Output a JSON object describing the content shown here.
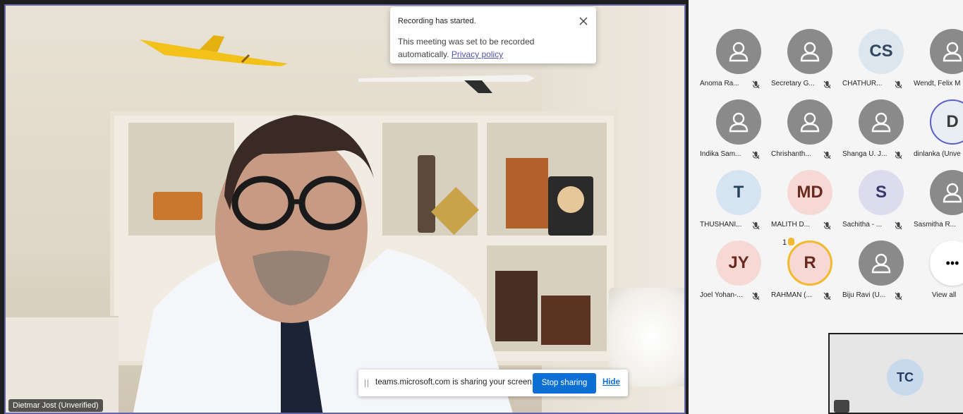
{
  "toast": {
    "title": "Recording has started.",
    "body": "This meeting was set to be recorded automatically.",
    "link": "Privacy policy"
  },
  "sharing_bar": {
    "message": "teams.microsoft.com is sharing your screen.",
    "stop_label": "Stop sharing",
    "hide_label": "Hide"
  },
  "main_video": {
    "participant_name": "Dietmar Jost (Unverified)"
  },
  "gallery": {
    "participants": [
      {
        "name": "Anoma Ra...",
        "initials": "",
        "avatar_color": "#8a8a8a",
        "text_color": "#ffffff",
        "muted": true
      },
      {
        "name": "Secretary G...",
        "initials": "",
        "avatar_color": "#8a8a8a",
        "text_color": "#ffffff",
        "muted": true
      },
      {
        "name": "CHATHUR...",
        "initials": "CS",
        "avatar_color": "#dce6ef",
        "text_color": "#33475e",
        "muted": true
      },
      {
        "name": "Wendt, Felix M",
        "initials": "",
        "avatar_color": "#8a8a8a",
        "text_color": "#ffffff",
        "muted": false
      },
      {
        "name": "Indika Sam...",
        "initials": "",
        "avatar_color": "#8a8a8a",
        "text_color": "#ffffff",
        "muted": true
      },
      {
        "name": "Chrishanth...",
        "initials": "",
        "avatar_color": "#8a8a8a",
        "text_color": "#ffffff",
        "muted": true
      },
      {
        "name": "Shanga U. J...",
        "initials": "",
        "avatar_color": "#8a8a8a",
        "text_color": "#ffffff",
        "muted": true
      },
      {
        "name": "dinlanka (Unve",
        "initials": "D",
        "avatar_color": "#e9eef3",
        "text_color": "#3b3b3b",
        "muted": false
      },
      {
        "name": "THUSHANI...",
        "initials": "T",
        "avatar_color": "#d6e4f2",
        "text_color": "#27415c",
        "muted": true
      },
      {
        "name": "MALITH D...",
        "initials": "MD",
        "avatar_color": "#f6d9d4",
        "text_color": "#6b2a20",
        "muted": true
      },
      {
        "name": "Sachitha - ...",
        "initials": "S",
        "avatar_color": "#dddcef",
        "text_color": "#3b376b",
        "muted": true
      },
      {
        "name": "Sasmitha R...",
        "initials": "",
        "avatar_color": "#8a8a8a",
        "text_color": "#ffffff",
        "muted": false
      },
      {
        "name": "Joel Yohan-...",
        "initials": "JY",
        "avatar_color": "#f6d9d4",
        "text_color": "#6b2a20",
        "muted": true
      },
      {
        "name": "RAHMAN (...",
        "initials": "R",
        "avatar_color": "#f6d9d4",
        "text_color": "#6b2a20",
        "muted": true,
        "raised_hand": "1"
      },
      {
        "name": "Biju Ravi (U...",
        "initials": "",
        "avatar_color": "#8a8a8a",
        "text_color": "#ffffff",
        "muted": true
      },
      {
        "name": "View all",
        "initials": "",
        "more": true
      }
    ],
    "more_label": "View all"
  },
  "self_view": {
    "initials": "TC"
  }
}
